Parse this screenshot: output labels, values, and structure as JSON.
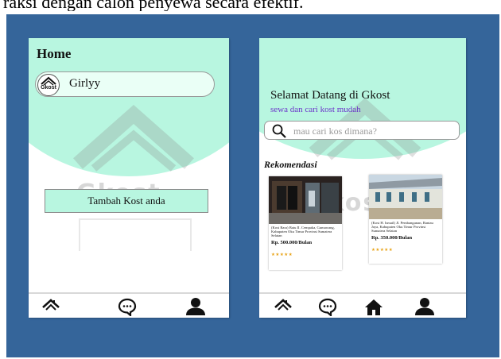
{
  "caption_fragment": "raksi dengan calon penyewa secara efektif.",
  "left_screen": {
    "title": "Home",
    "profile": {
      "logo_text": "Gkost",
      "name": "Girlyy"
    },
    "add_button_label": "Tambah Kost anda",
    "watermark_text": "Gkost",
    "nav": [
      "home-roof-icon",
      "chat-icon",
      "user-icon"
    ]
  },
  "right_screen": {
    "greeting": "Selamat Datang di Gkost",
    "tagline": "sewa dan cari kost mudah",
    "search": {
      "placeholder": "mau cari kos dimana?",
      "icon": "search-icon"
    },
    "section_title": "Rekomendasi",
    "watermark_text": "Gkost",
    "listings": [
      {
        "address": "(Kost Rara) Batu II. Cempaka, Gumawang, Kabupaten Oku Timur Provinsi Sumatera Selatan",
        "price": "Rp. 500.000/Bulan",
        "stars": "★★★★★"
      },
      {
        "address": "(Kost H. Ismail) Jl. Pembangunan, Rantau Jaya, Kabupaten Oku Timur Provinsi Sumatera Selatan",
        "price": "Rp. 350.000/Bulan",
        "stars": "★★★★★"
      }
    ],
    "nav": [
      "home-roof-icon",
      "chat-icon",
      "house-icon",
      "user-icon"
    ]
  },
  "colors": {
    "background": "#35659a",
    "accent_mint": "#b8f6e0",
    "tagline_purple": "#6b34c9",
    "star_gold": "#e8a317"
  }
}
